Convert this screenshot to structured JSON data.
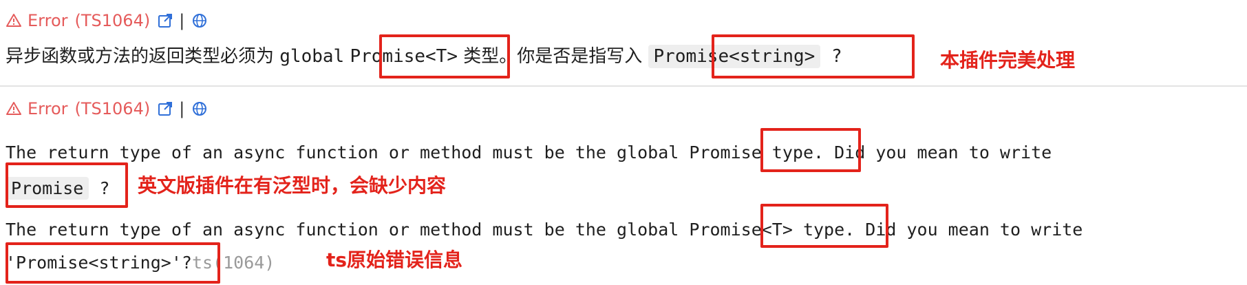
{
  "problem_1": {
    "severity": "Error",
    "code": "(TS1064)",
    "separator": "|",
    "message_prefix": "异步函数或方法的返回类型必须为 ",
    "global_word": "global",
    "promise_t": "Promise<T>",
    "message_mid": " 类型。你是否是指写入 ",
    "suggestion": "Promise<string>",
    "message_suffix": " ?",
    "annotation": "本插件完美处理"
  },
  "problem_2": {
    "severity": "Error",
    "code": "(TS1064)",
    "separator": "|",
    "en_line1_prefix": "The return type of an async function or method must be the global ",
    "en_line1_type": "Promise",
    "en_line1_suffix": " type. Did you mean to write",
    "en_line2_suggestion": "Promise",
    "en_line2_suffix": " ?",
    "annotation_en": "英文版插件在有泛型时，会缺少内容",
    "raw_line1_prefix": "The return type of an async function or method must be the global ",
    "raw_line1_type": "Promise<T>",
    "raw_line1_suffix": " type. Did you mean to write",
    "raw_line2_suggestion": "'Promise<string>'?",
    "raw_line2_source": "ts(1064)",
    "annotation_raw": "ts原始错误信息"
  },
  "colors": {
    "error": "#e55b5b",
    "annotation_red": "#e3231b",
    "link_blue": "#2f6fd8",
    "muted_gray": "#9a9a9a",
    "chip_bg": "#eeeeee"
  },
  "icons": {
    "warning": "warning-triangle-icon",
    "external": "external-link-icon",
    "globe": "globe-icon"
  }
}
